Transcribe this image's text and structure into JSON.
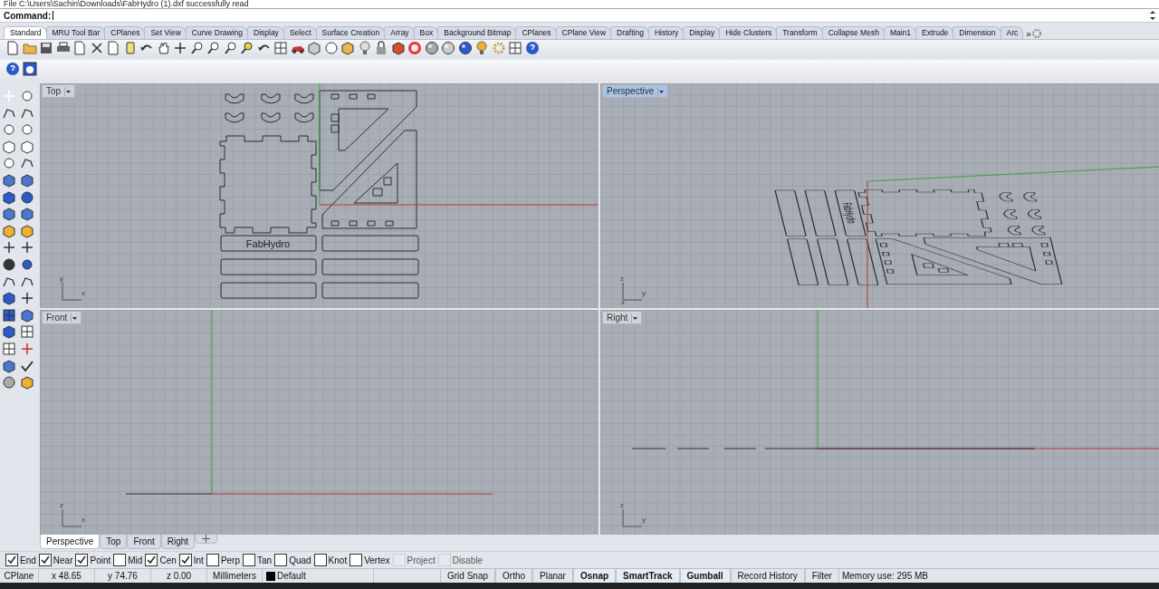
{
  "history_line": "File C:\\Users\\Sachin\\Downloads\\FabHydro (1).dxf successfully read",
  "command": {
    "label": "Command:"
  },
  "toolbar_tabs": [
    {
      "label": "Standard",
      "selected": true
    },
    {
      "label": "MRU Tool Bar",
      "selected": false
    },
    {
      "label": "CPlanes",
      "selected": false
    },
    {
      "label": "Set View",
      "selected": false
    },
    {
      "label": "Curve Drawing",
      "selected": false
    },
    {
      "label": "Display",
      "selected": false
    },
    {
      "label": "Select",
      "selected": false
    },
    {
      "label": "Surface Creation",
      "selected": false
    },
    {
      "label": "Array",
      "selected": false
    },
    {
      "label": "Box",
      "selected": false
    },
    {
      "label": "Background Bitmap",
      "selected": false
    },
    {
      "label": "CPlanes",
      "selected": false
    },
    {
      "label": "CPlane View",
      "selected": false
    },
    {
      "label": "Drafting",
      "selected": false
    },
    {
      "label": "History",
      "selected": false
    },
    {
      "label": "Display",
      "selected": false
    },
    {
      "label": "Hide Clusters",
      "selected": false
    },
    {
      "label": "Transform",
      "selected": false
    },
    {
      "label": "Collapse Mesh",
      "selected": false
    },
    {
      "label": "Main1",
      "selected": false
    },
    {
      "label": "Extrude",
      "selected": false
    },
    {
      "label": "Dimension",
      "selected": false
    },
    {
      "label": "Arc",
      "selected": false
    }
  ],
  "more_tabs": "»",
  "viewports": [
    {
      "title": "Top",
      "kind": "top",
      "active": false,
      "axes": [
        "y",
        "x"
      ],
      "part_label": "FabHydro"
    },
    {
      "title": "Perspective",
      "kind": "perspective",
      "active": true,
      "axes": [
        "z",
        "y",
        "x"
      ],
      "part_label": "FabHydro"
    },
    {
      "title": "Front",
      "kind": "front",
      "active": false,
      "axes": [
        "z",
        "x"
      ]
    },
    {
      "title": "Right",
      "kind": "right",
      "active": false,
      "axes": [
        "z",
        "y"
      ]
    }
  ],
  "viewport_tabs": [
    {
      "label": "Perspective",
      "selected": true
    },
    {
      "label": "Top",
      "selected": false
    },
    {
      "label": "Front",
      "selected": false
    },
    {
      "label": "Right",
      "selected": false
    }
  ],
  "osnaps": [
    {
      "label": "End",
      "checked": true,
      "disabled": false
    },
    {
      "label": "Near",
      "checked": true,
      "disabled": false
    },
    {
      "label": "Point",
      "checked": true,
      "disabled": false
    },
    {
      "label": "Mid",
      "checked": false,
      "disabled": false
    },
    {
      "label": "Cen",
      "checked": true,
      "disabled": false
    },
    {
      "label": "Int",
      "checked": true,
      "disabled": false
    },
    {
      "label": "Perp",
      "checked": false,
      "disabled": false
    },
    {
      "label": "Tan",
      "checked": false,
      "disabled": false
    },
    {
      "label": "Quad",
      "checked": false,
      "disabled": false
    },
    {
      "label": "Knot",
      "checked": false,
      "disabled": false
    },
    {
      "label": "Vertex",
      "checked": false,
      "disabled": false
    },
    {
      "label": "Project",
      "checked": false,
      "disabled": true
    },
    {
      "label": "Disable",
      "checked": false,
      "disabled": true
    }
  ],
  "status": {
    "cplane": "CPlane",
    "x": "x 48.65",
    "y": "y 74.76",
    "z": "z 0.00",
    "units": "Millimeters",
    "layer": "Default",
    "toggles": [
      {
        "label": "Grid Snap",
        "on": false
      },
      {
        "label": "Ortho",
        "on": false
      },
      {
        "label": "Planar",
        "on": false
      },
      {
        "label": "Osnap",
        "on": true
      },
      {
        "label": "SmartTrack",
        "on": true
      },
      {
        "label": "Gumball",
        "on": true
      },
      {
        "label": "Record History",
        "on": false
      },
      {
        "label": "Filter",
        "on": false
      }
    ],
    "memory": "Memory use: 295 MB"
  }
}
